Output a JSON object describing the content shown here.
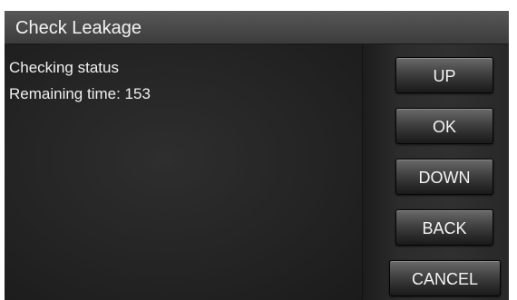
{
  "window": {
    "title": "Check Leakage"
  },
  "status": {
    "line1": "Checking status",
    "line2": "Remaining time: 153"
  },
  "buttons": {
    "up": "UP",
    "ok": "OK",
    "down": "DOWN",
    "back": "BACK",
    "cancel": "CANCEL"
  },
  "colors": {
    "background": "#2a2a2a",
    "title_bar": "#4a4a4a",
    "text": "#f0f0f0",
    "button": "#454545"
  }
}
